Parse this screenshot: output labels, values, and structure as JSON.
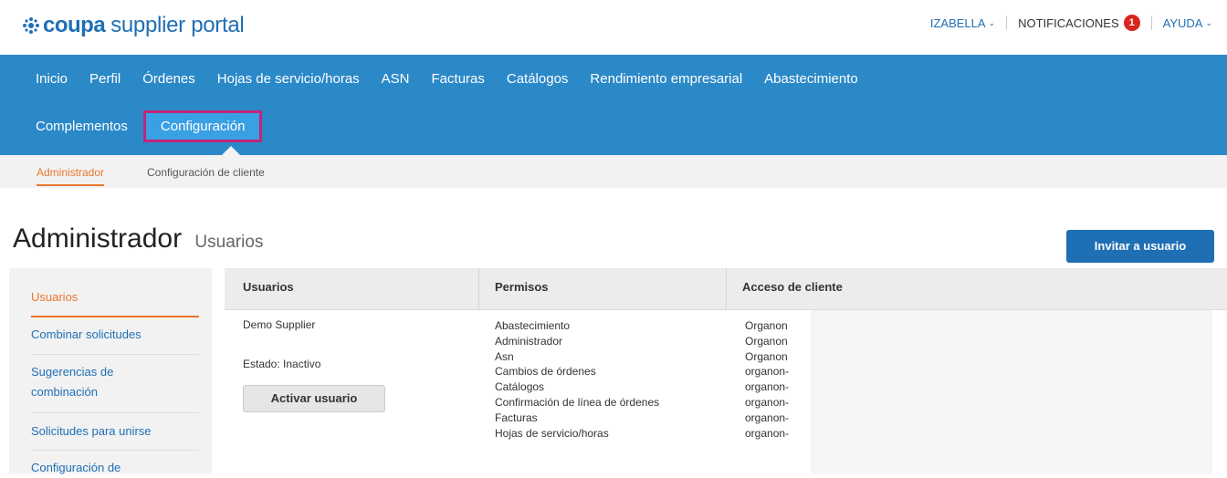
{
  "brand": {
    "name": "coupa",
    "product": "supplier portal"
  },
  "top_nav": {
    "user": "IZABELLA",
    "notifications_label": "NOTIFICACIONES",
    "notifications_count": "1",
    "help": "AYUDA"
  },
  "main_nav": {
    "row1": [
      "Inicio",
      "Perfil",
      "Órdenes",
      "Hojas de servicio/horas",
      "ASN",
      "Facturas",
      "Catálogos",
      "Rendimiento empresarial",
      "Abastecimiento"
    ],
    "row2": [
      "Complementos",
      "Configuración"
    ],
    "active": "Configuración"
  },
  "sub_nav": {
    "items": [
      "Administrador",
      "Configuración de cliente"
    ],
    "active": "Administrador"
  },
  "page": {
    "title": "Administrador",
    "subtitle": "Usuarios",
    "invite_button": "Invitar a usuario"
  },
  "sidebar": {
    "items": [
      "Usuarios",
      "Combinar solicitudes",
      "Sugerencias de combinación",
      "Solicitudes para unirse",
      "Configuración de"
    ],
    "active": "Usuarios"
  },
  "table": {
    "headers": [
      "Usuarios",
      "Permisos",
      "Acceso de cliente"
    ],
    "user": {
      "name": "Demo Supplier",
      "status": "Estado: Inactivo",
      "activate_button": "Activar usuario"
    },
    "permissions": [
      "Abastecimiento",
      "Administrador",
      "Asn",
      "Cambios de órdenes",
      "Catálogos",
      "Confirmación de línea de órdenes",
      "Facturas",
      "Hojas de servicio/horas"
    ],
    "client_access": [
      "Organon",
      "Organon",
      "Organon",
      "organon-",
      "organon-",
      "organon-",
      "organon-",
      "organon-"
    ]
  },
  "colors": {
    "brand_blue": "#1f6fb5",
    "nav_blue": "#2b89c8",
    "accent_orange": "#e8772e",
    "highlight_magenta": "#c0267a",
    "badge_red": "#d9261c"
  }
}
